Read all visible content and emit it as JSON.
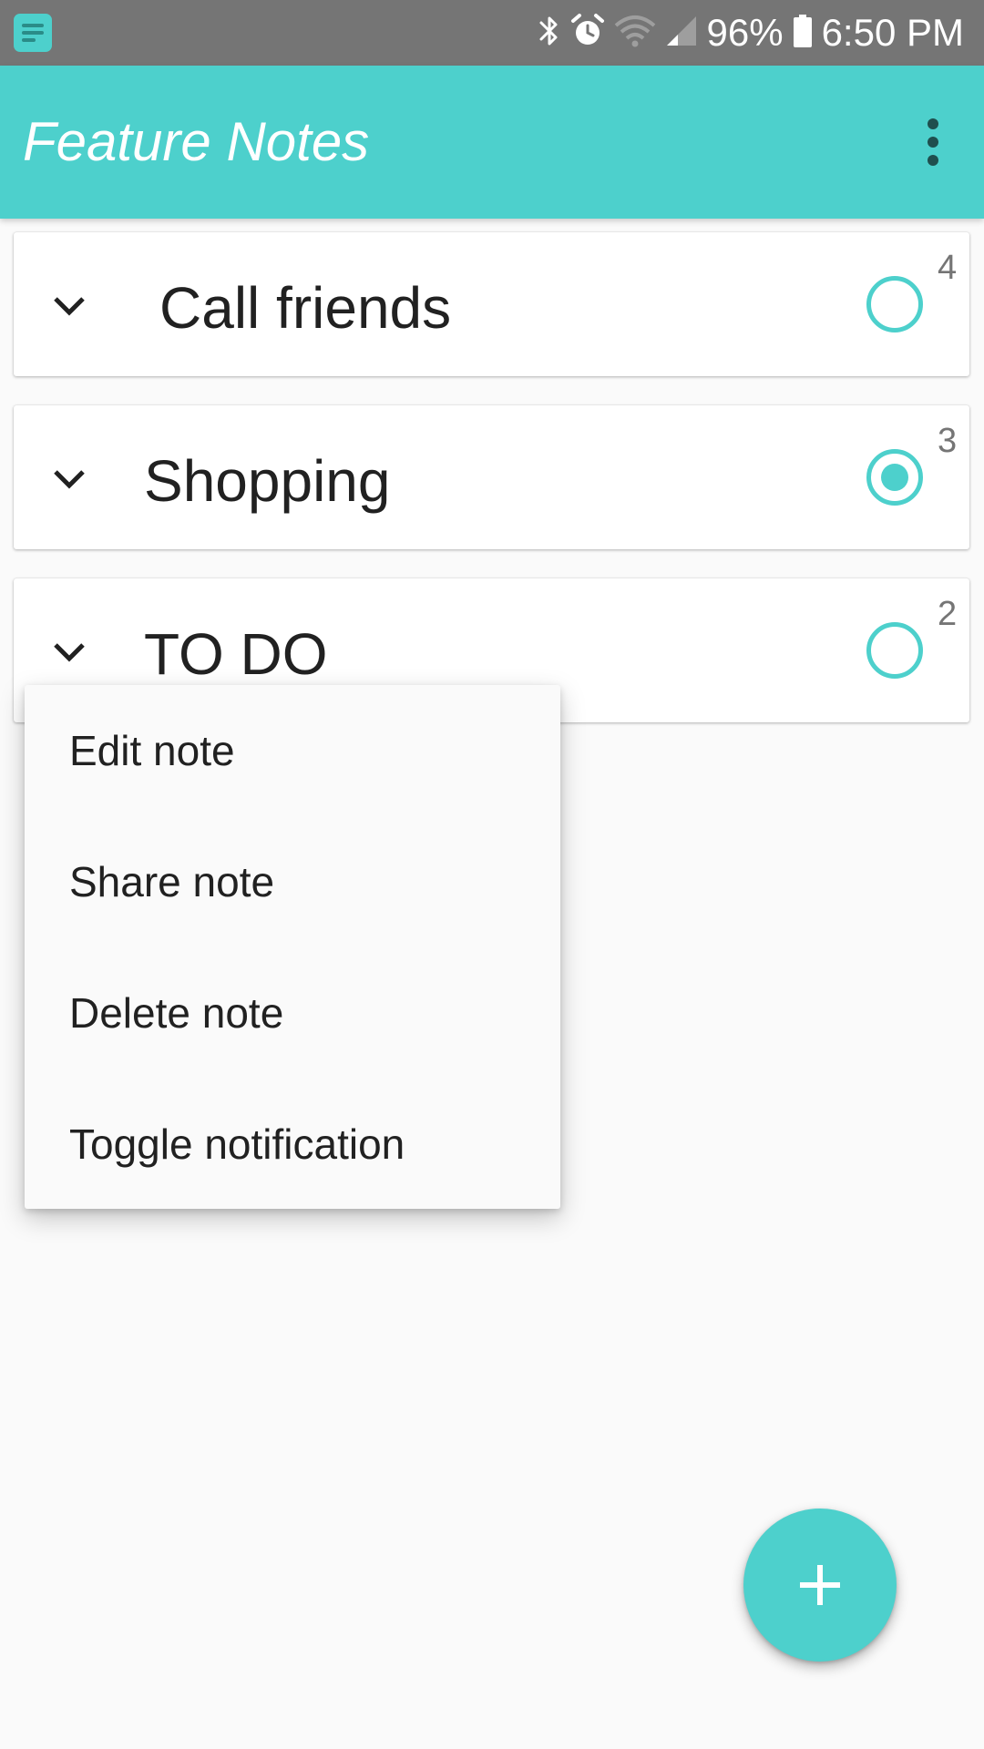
{
  "status_bar": {
    "battery_percent": "96%",
    "time": "6:50 PM",
    "icons": [
      "notes-app-icon",
      "bluetooth-icon",
      "alarm-icon",
      "wifi-icon",
      "signal-icon",
      "battery-icon"
    ]
  },
  "app_bar": {
    "title": "Feature Notes",
    "overflow_icon": "more-vert-icon"
  },
  "notes": [
    {
      "title": "Call friends",
      "count": "4",
      "selected": false
    },
    {
      "title": "Shopping",
      "count": "3",
      "selected": true
    },
    {
      "title": "TO DO",
      "count": "2",
      "selected": false
    }
  ],
  "context_menu": {
    "items": [
      {
        "label": "Edit note"
      },
      {
        "label": "Share note"
      },
      {
        "label": "Delete note"
      },
      {
        "label": "Toggle notification"
      }
    ]
  },
  "fab": {
    "icon": "plus-icon"
  },
  "colors": {
    "accent": "#4dd0cc",
    "status_bar": "#757575",
    "background": "#fafafa",
    "text_primary": "#212121",
    "text_secondary": "#757575"
  }
}
